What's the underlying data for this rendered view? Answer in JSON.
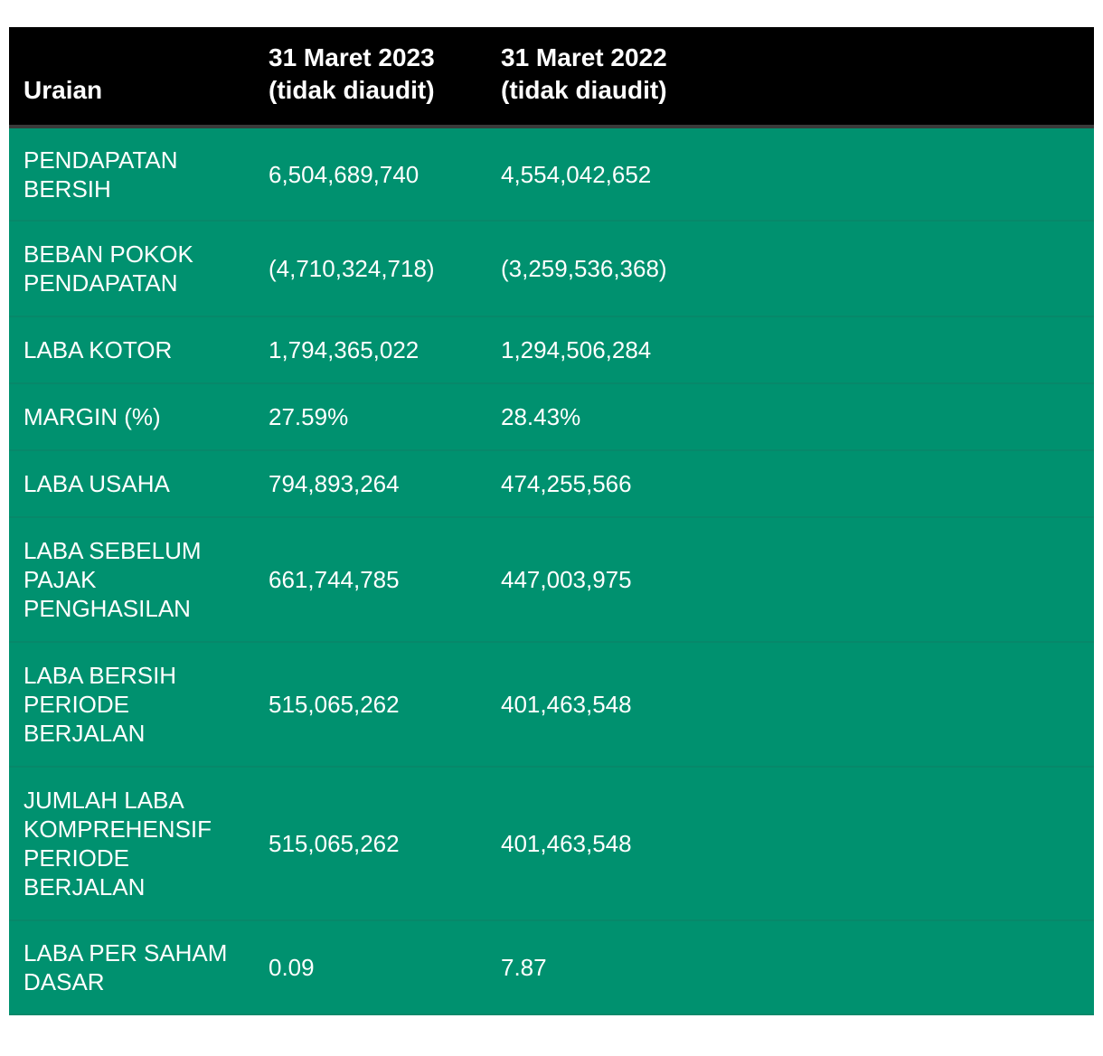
{
  "table": {
    "headers": [
      "Uraian",
      "31 Maret 2023 (tidak diaudit)",
      "31 Maret 2022 (tidak diaudit)",
      ""
    ],
    "rows": [
      {
        "label": "PENDAPATAN BERSIH",
        "y2023": "6,504,689,740",
        "y2022": "4,554,042,652"
      },
      {
        "label": "BEBAN POKOK PENDAPATAN",
        "y2023": "(4,710,324,718)",
        "y2022": "(3,259,536,368)"
      },
      {
        "label": "LABA KOTOR",
        "y2023": "1,794,365,022",
        "y2022": "1,294,506,284"
      },
      {
        "label": "MARGIN (%)",
        "y2023": "27.59%",
        "y2022": "28.43%"
      },
      {
        "label": "LABA USAHA",
        "y2023": "794,893,264",
        "y2022": "474,255,566"
      },
      {
        "label": "LABA SEBELUM PAJAK PENGHASILAN",
        "y2023": "661,744,785",
        "y2022": "447,003,975"
      },
      {
        "label": "LABA BERSIH PERIODE BERJALAN",
        "y2023": "515,065,262",
        "y2022": "401,463,548"
      },
      {
        "label": "JUMLAH LABA KOMPREHENSIF PERIODE BERJALAN",
        "y2023": "515,065,262",
        "y2022": "401,463,548"
      },
      {
        "label": "LABA PER SAHAM DASAR",
        "y2023": "0.09",
        "y2022": "7.87"
      }
    ]
  },
  "colors": {
    "header_bg": "#000000",
    "row_bg": "#00916f",
    "text": "#ffffff"
  }
}
